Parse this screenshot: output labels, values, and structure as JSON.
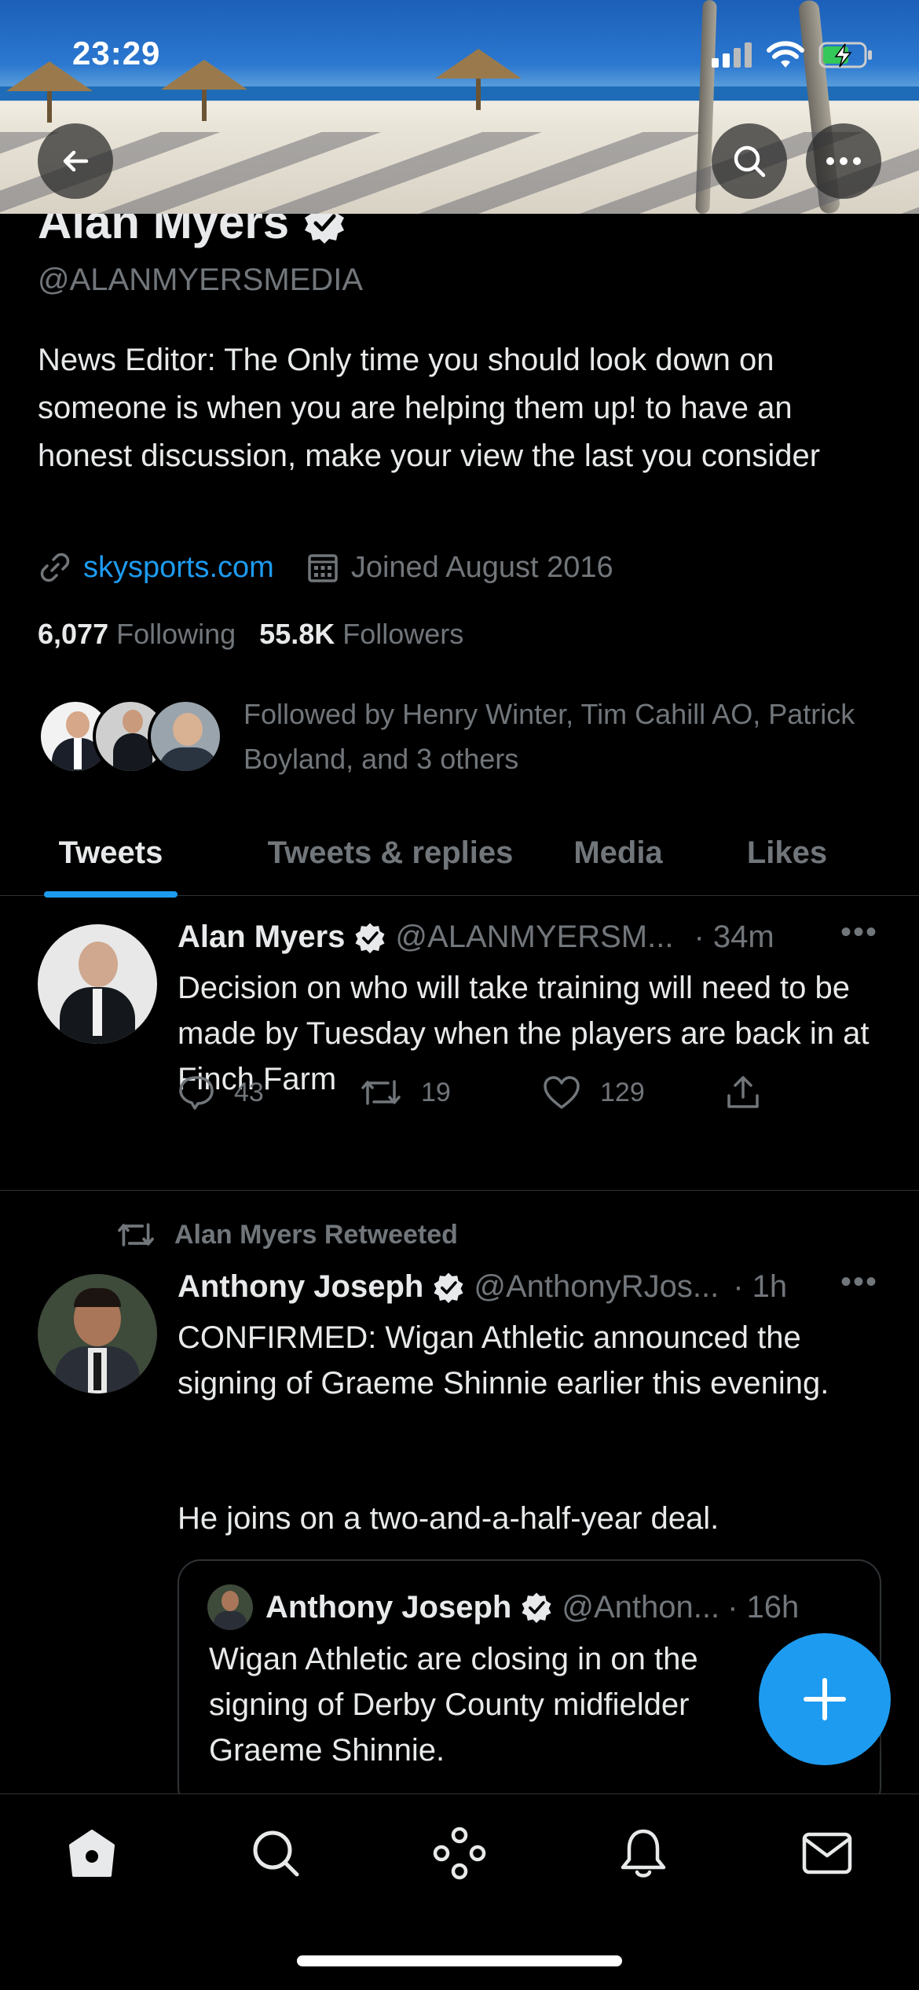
{
  "status_bar": {
    "time": "23:29"
  },
  "profile": {
    "name": "Alan Myers",
    "handle": "@ALANMYERSMEDIA",
    "bio": "News Editor: The Only time you should look down on someone is when you are helping them up! to have an honest discussion, make your view the last you consider",
    "website": "skysports.com",
    "joined": "Joined August 2016",
    "following_count": "6,077",
    "following_label": "Following",
    "followers_count": "55.8K",
    "followers_label": "Followers",
    "followed_by": "Followed by Henry Winter, Tim Cahill AO, Patrick Boyland, and 3 others"
  },
  "tabs": [
    {
      "label": "Tweets",
      "active": true
    },
    {
      "label": "Tweets & replies",
      "active": false
    },
    {
      "label": "Media",
      "active": false
    },
    {
      "label": "Likes",
      "active": false
    }
  ],
  "tweets": [
    {
      "author": "Alan Myers",
      "handle": "@ALANMYERSM...",
      "time": "· 34m",
      "text": "Decision on who will take training will need to be made by Tuesday when the players are back in at Finch Farm",
      "replies": "43",
      "retweets": "19",
      "likes": "129"
    },
    {
      "retweet_label": "Alan Myers Retweeted",
      "author": "Anthony Joseph",
      "handle": "@AnthonyRJos...",
      "time": "· 1h",
      "text1": "CONFIRMED: Wigan Athletic announced the signing of Graeme Shinnie earlier this evening.",
      "text2": "He joins on a two-and-a-half-year deal.",
      "quote": {
        "author": "Anthony Joseph",
        "handle": "@Anthon...",
        "time": "· 16h",
        "text": "Wigan Athletic are closing in on the signing of Derby County midfielder Graeme Shinnie."
      }
    }
  ],
  "colors": {
    "accent": "#1d9bf0",
    "background": "#000000",
    "muted": "#71767b",
    "text": "#e7e9ea"
  },
  "icons": {
    "header": [
      "back-arrow-icon",
      "search-icon",
      "more-icon"
    ],
    "nav": [
      "home-icon",
      "search-icon",
      "spaces-icon",
      "notifications-icon",
      "messages-icon"
    ],
    "tweet_actions": [
      "reply-icon",
      "retweet-icon",
      "like-icon",
      "share-icon"
    ]
  }
}
